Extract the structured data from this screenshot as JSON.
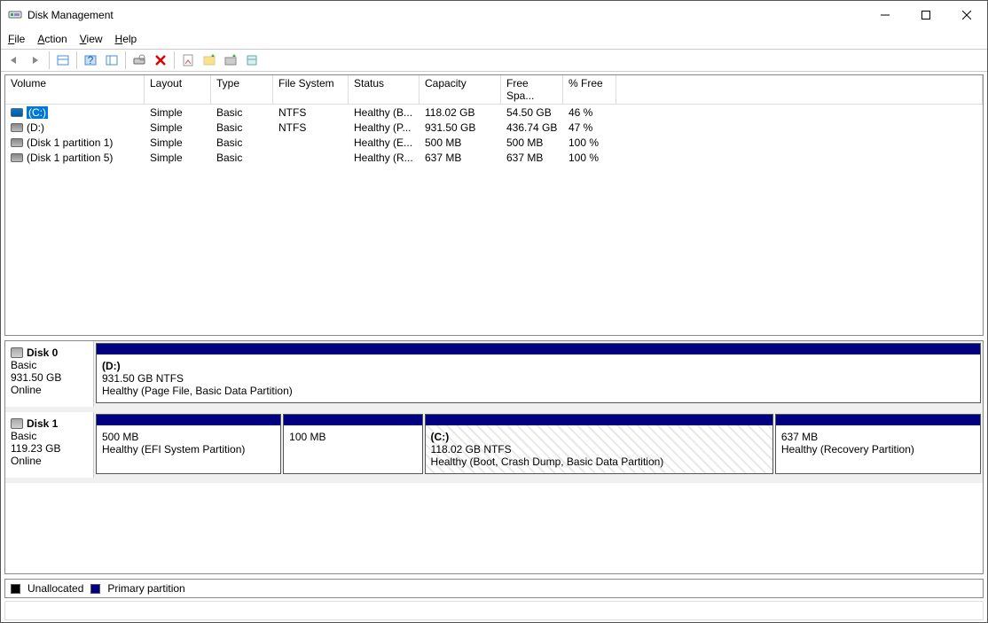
{
  "title": "Disk Management",
  "menus": {
    "file": "File",
    "action": "Action",
    "view": "View",
    "help": "Help"
  },
  "columns": [
    "Volume",
    "Layout",
    "Type",
    "File System",
    "Status",
    "Capacity",
    "Free Spa...",
    "% Free"
  ],
  "volumes": [
    {
      "name": "(C:)",
      "layout": "Simple",
      "type": "Basic",
      "fs": "NTFS",
      "status": "Healthy (B...",
      "capacity": "118.02 GB",
      "free": "54.50 GB",
      "pct": "46 %",
      "selected": true,
      "icon": "ssd"
    },
    {
      "name": "(D:)",
      "layout": "Simple",
      "type": "Basic",
      "fs": "NTFS",
      "status": "Healthy (P...",
      "capacity": "931.50 GB",
      "free": "436.74 GB",
      "pct": "47 %",
      "selected": false,
      "icon": "hdd"
    },
    {
      "name": "(Disk 1 partition 1)",
      "layout": "Simple",
      "type": "Basic",
      "fs": "",
      "status": "Healthy (E...",
      "capacity": "500 MB",
      "free": "500 MB",
      "pct": "100 %",
      "selected": false,
      "icon": "hdd"
    },
    {
      "name": "(Disk 1 partition 5)",
      "layout": "Simple",
      "type": "Basic",
      "fs": "",
      "status": "Healthy (R...",
      "capacity": "637 MB",
      "free": "637 MB",
      "pct": "100 %",
      "selected": false,
      "icon": "hdd"
    }
  ],
  "disks": [
    {
      "name": "Disk 0",
      "type": "Basic",
      "size": "931.50 GB",
      "status": "Online",
      "partitions": [
        {
          "label": "(D:)",
          "size": "931.50 GB NTFS",
          "status": "Healthy (Page File, Basic Data Partition)",
          "flex": 1000,
          "selected": false
        }
      ]
    },
    {
      "name": "Disk 1",
      "type": "Basic",
      "size": "119.23 GB",
      "status": "Online",
      "partitions": [
        {
          "label": "",
          "size": "500 MB",
          "status": "Healthy (EFI System Partition)",
          "flex": 180,
          "selected": false
        },
        {
          "label": "",
          "size": "100 MB",
          "status": "",
          "flex": 135,
          "selected": false
        },
        {
          "label": "(C:)",
          "size": "118.02 GB NTFS",
          "status": "Healthy (Boot, Crash Dump, Basic Data Partition)",
          "flex": 340,
          "selected": true
        },
        {
          "label": "",
          "size": "637 MB",
          "status": "Healthy (Recovery Partition)",
          "flex": 200,
          "selected": false
        }
      ]
    }
  ],
  "legend": {
    "unallocated": "Unallocated",
    "primary": "Primary partition"
  }
}
